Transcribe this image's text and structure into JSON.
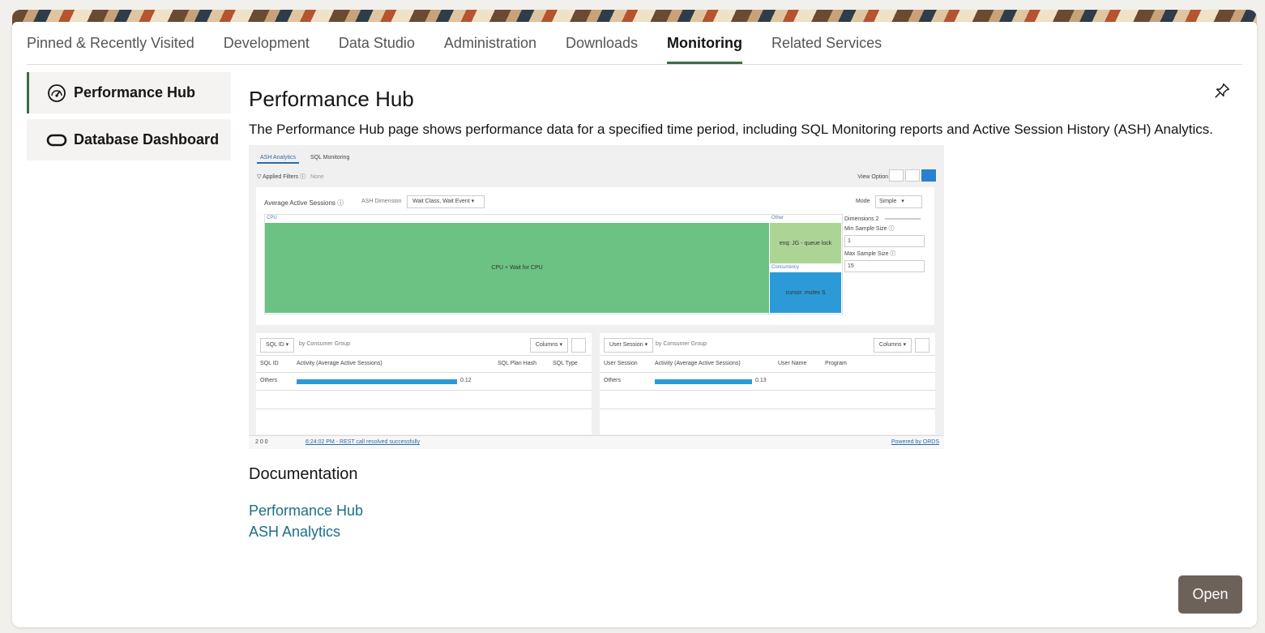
{
  "tabs": [
    {
      "label": "Pinned & Recently Visited",
      "active": false
    },
    {
      "label": "Development",
      "active": false
    },
    {
      "label": "Data Studio",
      "active": false
    },
    {
      "label": "Administration",
      "active": false
    },
    {
      "label": "Downloads",
      "active": false
    },
    {
      "label": "Monitoring",
      "active": true
    },
    {
      "label": "Related Services",
      "active": false
    }
  ],
  "sidebar": {
    "items": [
      {
        "label": "Performance Hub",
        "icon": "gauge-icon",
        "active": true
      },
      {
        "label": "Database Dashboard",
        "icon": "oracle-ring-icon",
        "active": false
      }
    ]
  },
  "main": {
    "title": "Performance Hub",
    "description": "The Performance Hub page shows performance data for a specified time period, including SQL Monitoring reports and Active Session History (ASH) Analytics.",
    "pin_icon": "pin-icon",
    "preview": {
      "tabs": [
        "ASH Analytics",
        "SQL Monitoring"
      ],
      "applied_filters_label": "Applied Filters",
      "applied_filters_value": "None",
      "view_option_label": "View Option",
      "panel_title": "Average Active Sessions",
      "ash_dimension_label": "ASH Dimension",
      "ash_dimension_value": "Wait Class, Wait Event",
      "mode_label": "Mode",
      "mode_value": "Simple",
      "treemap": {
        "cpu_label": "CPU",
        "cpu_cell": "CPU + Wait for CPU",
        "other_label": "Other",
        "other_cell": "enq: JG - queue lock",
        "concurrency_label": "Concurrency",
        "concurrency_cell": "cursor: mutex S"
      },
      "dimensions_label": "Dimensions",
      "dimensions_value": "2",
      "min_sample_label": "Min Sample Size",
      "min_sample_value": "1",
      "max_sample_label": "Max Sample Size",
      "max_sample_value": "15",
      "left_table": {
        "selector": "SQL ID",
        "by": "by Consumer Group",
        "columns_btn": "Columns",
        "headers": [
          "SQL ID",
          "Activity (Average Active Sessions)",
          "SQL Plan Hash",
          "SQL Type"
        ],
        "row_label": "Others",
        "row_value": "0.12",
        "row_fraction": 0.92
      },
      "right_table": {
        "selector": "User Session",
        "by": "by Consumer Group",
        "columns_btn": "Columns",
        "headers": [
          "User Session",
          "Activity (Average Active Sessions)",
          "User Name",
          "Program"
        ],
        "row_label": "Others",
        "row_value": "0.13",
        "row_fraction": 0.92
      },
      "footer_counts": "2  0  0",
      "footer_msg": "6:24:02 PM - REST call resolved successfully",
      "footer_powered": "Powered by ORDS"
    },
    "documentation_title": "Documentation",
    "doc_links": [
      "Performance Hub",
      "ASH Analytics"
    ]
  },
  "open_button": "Open",
  "colors": {
    "accent": "#3d6b4a",
    "link": "#1c6e8c",
    "button": "#6d625a",
    "treemap_green": "#6bc283",
    "treemap_light_green": "#acd495",
    "treemap_blue": "#2d9ad8"
  }
}
